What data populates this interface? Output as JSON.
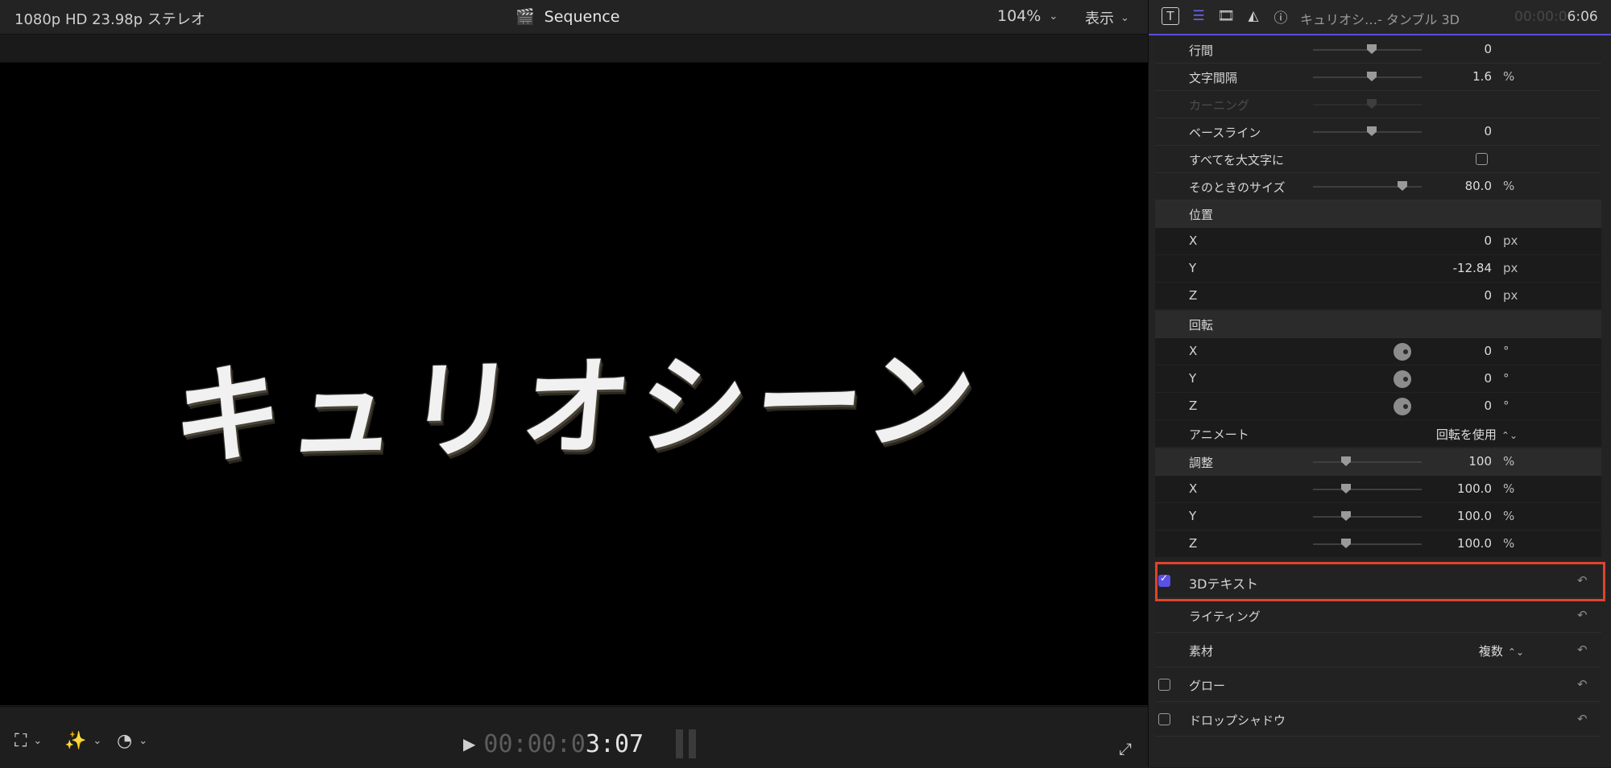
{
  "viewer": {
    "format_label": "1080p HD 23.98p ステレオ",
    "sequence_title": "Sequence",
    "zoom_level": "104%",
    "view_menu": "表示",
    "canvas_text": "キュリオシーン",
    "timecode_dim": "00:00:0",
    "timecode_lit": "3:07"
  },
  "inspector": {
    "clip_title": "キュリオシ…- タンブル 3D",
    "time_dim": "00:00:0",
    "time_lit": "6:06",
    "rows": {
      "line_spacing": {
        "label": "行間",
        "value": "0",
        "unit": ""
      },
      "tracking": {
        "label": "文字間隔",
        "value": "1.6",
        "unit": "%"
      },
      "kerning": {
        "label": "カーニング"
      },
      "baseline": {
        "label": "ベースライン",
        "value": "0"
      },
      "all_caps": {
        "label": "すべてを大文字に"
      },
      "caps_size": {
        "label": "そのときのサイズ",
        "value": "80.0",
        "unit": "%"
      },
      "position": {
        "label": "位置"
      },
      "pos_x": {
        "label": "X",
        "value": "0",
        "unit": "px"
      },
      "pos_y": {
        "label": "Y",
        "value": "-12.84",
        "unit": "px"
      },
      "pos_z": {
        "label": "Z",
        "value": "0",
        "unit": "px"
      },
      "rotation": {
        "label": "回転"
      },
      "rot_x": {
        "label": "X",
        "value": "0",
        "unit": "°"
      },
      "rot_y": {
        "label": "Y",
        "value": "0",
        "unit": "°"
      },
      "rot_z": {
        "label": "Z",
        "value": "0",
        "unit": "°"
      },
      "animate": {
        "label": "アニメート",
        "value": "回転を使用"
      },
      "scale": {
        "label": "調整",
        "value": "100",
        "unit": "%"
      },
      "scale_x": {
        "label": "X",
        "value": "100.0",
        "unit": "%"
      },
      "scale_y": {
        "label": "Y",
        "value": "100.0",
        "unit": "%"
      },
      "scale_z": {
        "label": "Z",
        "value": "100.0",
        "unit": "%"
      },
      "text3d": {
        "label": "3Dテキスト",
        "checked": true
      },
      "lighting": {
        "label": "ライティング"
      },
      "material": {
        "label": "素材",
        "value": "複数"
      },
      "glow": {
        "label": "グロー",
        "checked": false
      },
      "drop_shadow": {
        "label": "ドロップシャドウ",
        "checked": false
      }
    }
  },
  "colors": {
    "accent": "#5a50e6",
    "highlight_box": "#e0432c"
  }
}
